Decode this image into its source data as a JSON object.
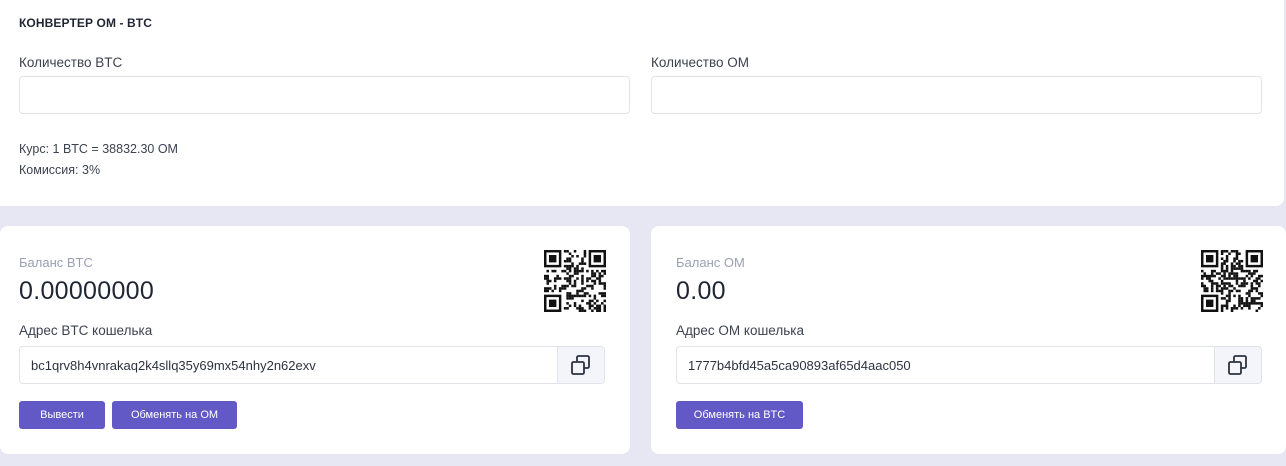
{
  "converter": {
    "title": "КОНВЕРТЕР ОМ - BTC",
    "btc_label": "Количество BTC",
    "btc_value": "",
    "om_label": "Количество ОМ",
    "om_value": "",
    "rate_text": "Курс: 1 BTC = 38832.30 OM",
    "commission_text": "Комиссия: 3%"
  },
  "btc_card": {
    "balance_label": "Баланс BTC",
    "balance_value": "0.00000000",
    "address_label": "Адрес BTC кошелька",
    "address": "bc1qrv8h4vnrakaq2k4sllq35y69mx54nhy2n62exv",
    "withdraw_button": "Вывести",
    "exchange_button": "Обменять на OM",
    "qr_icon": "qr-code-icon",
    "copy_icon": "copy-icon"
  },
  "om_card": {
    "balance_label": "Баланс ОМ",
    "balance_value": "0.00",
    "address_label": "Адрес ОМ кошелька",
    "address": "1777b4bfd45a5ca90893af65d4aac050",
    "exchange_button": "Обменять на BTC",
    "qr_icon": "qr-code-icon",
    "copy_icon": "copy-icon"
  },
  "colors": {
    "background": "#e6e7f2",
    "card": "#ffffff",
    "accent_button": "#6259c7",
    "muted_label": "#9aa0b3"
  }
}
